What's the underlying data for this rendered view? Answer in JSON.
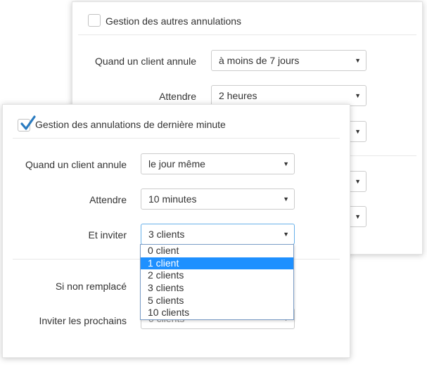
{
  "back_panel": {
    "title": "Gestion des autres annulations",
    "checked": false,
    "rows": [
      {
        "label": "Quand un client annule",
        "value": "à moins de 7 jours"
      },
      {
        "label": "Attendre",
        "value": "2 heures"
      }
    ]
  },
  "front_panel": {
    "title": "Gestion des annulations de dernière minute",
    "checked": true,
    "rows": [
      {
        "label": "Quand un client annule",
        "value": "le jour même"
      },
      {
        "label": "Attendre",
        "value": "10 minutes"
      },
      {
        "label": "Et inviter",
        "value": "3 clients"
      }
    ],
    "lower_rows": [
      {
        "label": "Si non remplacé"
      },
      {
        "label": "Inviter les prochains",
        "value": "0 clients"
      }
    ]
  },
  "dropdown": {
    "options": [
      "0 client",
      "1 client",
      "2 clients",
      "3 clients",
      "5 clients",
      "10 clients"
    ],
    "highlighted": "1 client"
  },
  "colors": {
    "checkbox_checked": "#2a7bc0",
    "highlight": "#1e90ff",
    "focus_border": "#66afe9"
  }
}
